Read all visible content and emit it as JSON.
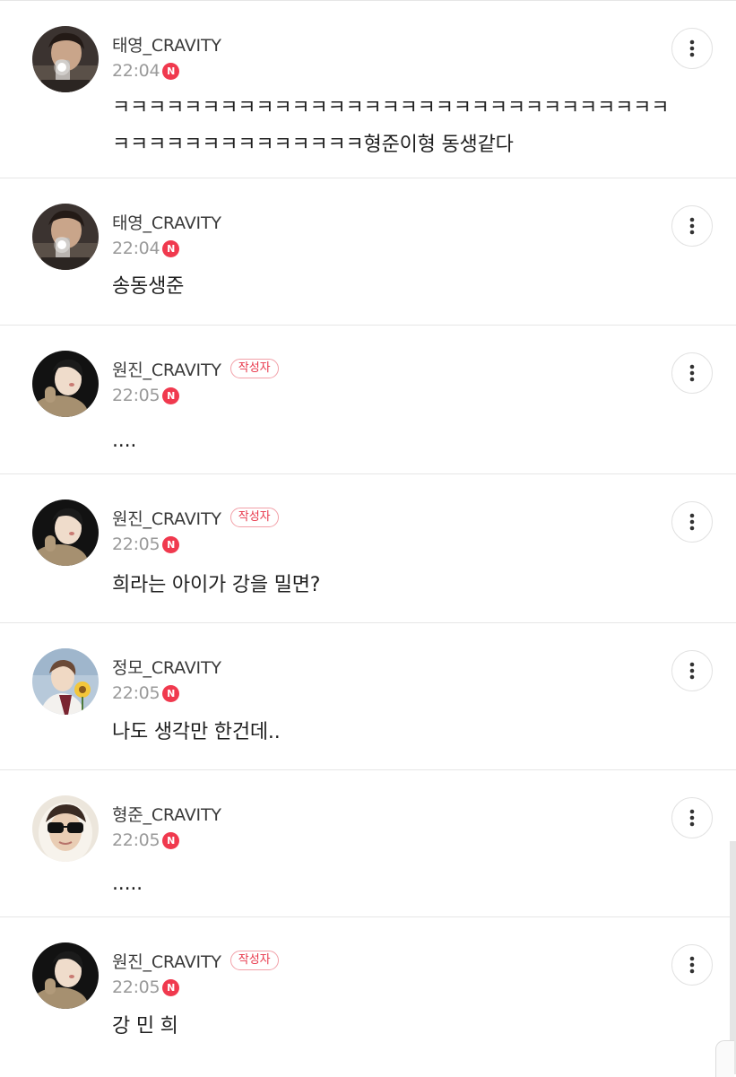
{
  "comments": [
    {
      "author": "태영_CRAVITY",
      "time": "22:04",
      "new_badge": "N",
      "text": "ㅋㅋㅋㅋㅋㅋㅋㅋㅋㅋㅋㅋㅋㅋㅋㅋㅋㅋㅋㅋㅋㅋㅋㅋㅋㅋㅋㅋㅋㅋㅋㅋㅋㅋㅋㅋㅋㅋㅋㅋㅋㅋㅋㅋㅋ형준이형 동생같다",
      "writer_badge": ""
    },
    {
      "author": "태영_CRAVITY",
      "time": "22:04",
      "new_badge": "N",
      "text": "송동생준",
      "writer_badge": ""
    },
    {
      "author": "원진_CRAVITY",
      "time": "22:05",
      "new_badge": "N",
      "text": "....",
      "writer_badge": "작성자"
    },
    {
      "author": "원진_CRAVITY",
      "time": "22:05",
      "new_badge": "N",
      "text": "희라는 아이가 강을 밀면?",
      "writer_badge": "작성자"
    },
    {
      "author": "정모_CRAVITY",
      "time": "22:05",
      "new_badge": "N",
      "text": "나도 생각만 한건데..",
      "writer_badge": ""
    },
    {
      "author": "형준_CRAVITY",
      "time": "22:05",
      "new_badge": "N",
      "text": ".....",
      "writer_badge": ""
    },
    {
      "author": "원진_CRAVITY",
      "time": "22:05",
      "new_badge": "N",
      "text": "강 민 희",
      "writer_badge": "작성자"
    }
  ],
  "icons": {
    "more": "more-vertical-icon",
    "avatar": "profile-avatar"
  },
  "colors": {
    "new_badge": "#f0394e",
    "writer_badge": "#e8374a",
    "divider": "#e6e6e6",
    "time": "#9a9a9a"
  }
}
